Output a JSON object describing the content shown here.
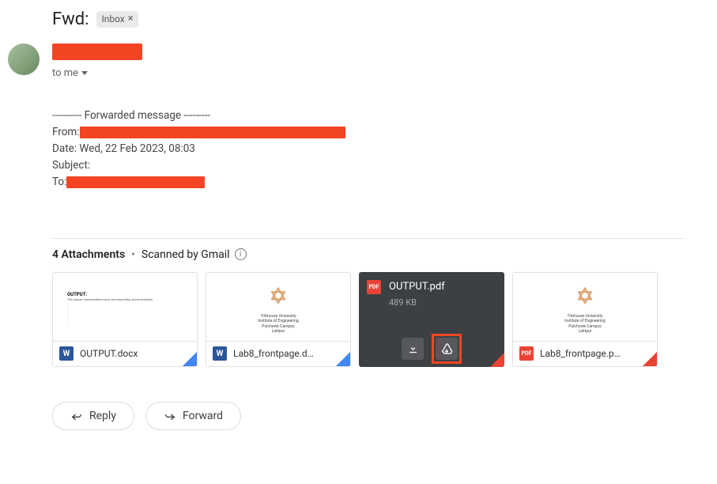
{
  "header": {
    "subject_prefix": "Fwd:",
    "inbox_chip": "Inbox"
  },
  "sender": {
    "to_line": "to me"
  },
  "body": {
    "separator": "---------- Forwarded message ---------",
    "from_label": "From:",
    "date_label": "Date:",
    "date_value": " Wed, 22 Feb 2023, 08:03",
    "subject_label": "Subject:",
    "to_label": "To:"
  },
  "attachments_header": {
    "count_label": "4 Attachments",
    "scanned_label": "Scanned by Gmail"
  },
  "attachments": [
    {
      "name": "OUTPUT.docx",
      "type": "word"
    },
    {
      "name": "Lab8_frontpage.d…",
      "type": "word"
    },
    {
      "name": "OUTPUT.pdf",
      "size": "489 KB",
      "type": "pdf"
    },
    {
      "name": "Lab8_frontpage.p…",
      "type": "pdf"
    }
  ],
  "actions": {
    "reply": "Reply",
    "forward": "Forward"
  },
  "icons": {
    "word": "W",
    "pdf": "PDF"
  },
  "preview_text": {
    "title": "OUTPUT:",
    "subtitle": "The output representation and corresponding documentation",
    "uni_line1": "Tribhuvan University",
    "uni_line2": "Institute of Engineering",
    "uni_line3": "Pulchowk Campus",
    "uni_line4": "Lalitpur"
  }
}
